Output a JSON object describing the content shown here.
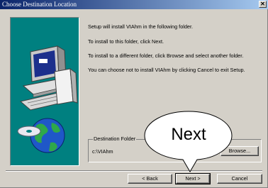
{
  "window": {
    "title": "Choose Destination Location",
    "close_glyph": "✕"
  },
  "message": {
    "line1": "Setup will install VIAhm in the following folder.",
    "line2": "To install to this folder, click Next.",
    "line3": "To install to a different folder, click Browse and select another folder.",
    "line4": "You can choose not to install VIAhm by clicking Cancel to exit Setup."
  },
  "destination": {
    "label": "Destination Folder",
    "path": "c:\\VIAhm",
    "browse_label": "Browse..."
  },
  "buttons": {
    "back_label": "< Back",
    "next_label": "Next >",
    "cancel_label": "Cancel"
  },
  "callout": {
    "text": "Next"
  },
  "colors": {
    "titlebar_start": "#0a246a",
    "titlebar_end": "#a6caf0",
    "dialog_face": "#d4d0c8",
    "art_background": "#008080"
  }
}
